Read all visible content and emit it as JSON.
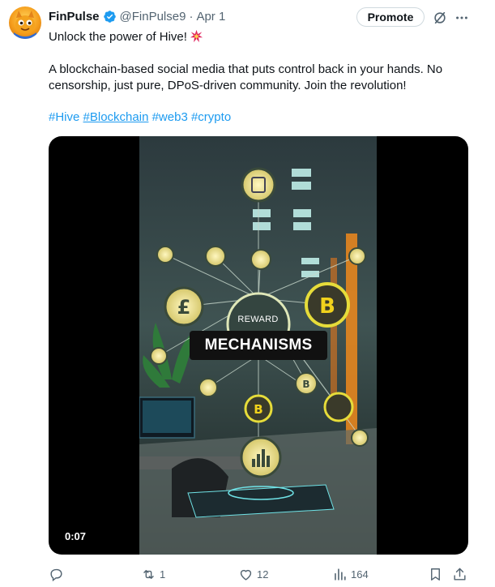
{
  "post": {
    "author_name": "FinPulse",
    "handle": "@FinPulse9",
    "separator": "·",
    "date": "Apr 1",
    "promote_label": "Promote",
    "line1": "Unlock the power of Hive!",
    "body": "A blockchain-based social media that puts control back in your hands. No censorship, just pure, DPoS-driven community. Join the revolution!",
    "hashtags": [
      "#Hive",
      "#Blockchain",
      "#web3",
      "#crypto"
    ]
  },
  "video": {
    "timestamp": "0:07",
    "caption_small": "REWARD",
    "caption_big": "MECHANISMS"
  },
  "actions": {
    "reply_count": "",
    "repost_count": "1",
    "like_count": "12",
    "views_count": "164"
  },
  "icons": {
    "verified": "verified-badge-icon",
    "grok": "grok-icon",
    "more": "more-icon",
    "reply": "reply-icon",
    "repost": "repost-icon",
    "like": "like-icon",
    "views": "views-icon",
    "bookmark": "bookmark-icon",
    "share": "share-icon"
  },
  "colors": {
    "accent": "#1d9bf0",
    "text": "#0f1419",
    "muted": "#536471"
  }
}
